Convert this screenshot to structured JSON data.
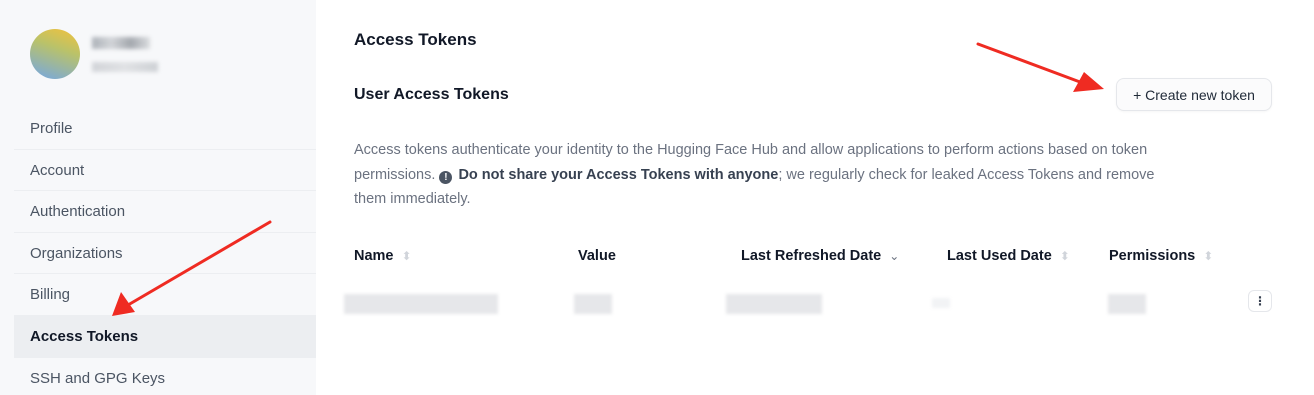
{
  "sidebar": {
    "items": [
      {
        "label": "Profile"
      },
      {
        "label": "Account"
      },
      {
        "label": "Authentication"
      },
      {
        "label": "Organizations"
      },
      {
        "label": "Billing"
      },
      {
        "label": "Access Tokens",
        "active": true
      },
      {
        "label": "SSH and GPG Keys"
      }
    ]
  },
  "main": {
    "title": "Access Tokens",
    "section_title": "User Access Tokens",
    "create_button": "+ Create new token",
    "description": {
      "part1": "Access tokens authenticate your identity to the Hugging Face Hub and allow applications to perform actions based on token permissions.",
      "warning": "Do not share your Access Tokens with anyone",
      "part2": "; we regularly check for leaked Access Tokens and remove them immediately."
    },
    "table": {
      "columns": [
        "Name",
        "Value",
        "Last Refreshed Date",
        "Last Used Date",
        "Permissions"
      ]
    },
    "row_menu_icon": "more-vertical-icon"
  },
  "colors": {
    "sidebar_bg": "#f7f8fa",
    "active_item_bg": "#eceef1",
    "annotation_arrow": "#ef2b22"
  }
}
